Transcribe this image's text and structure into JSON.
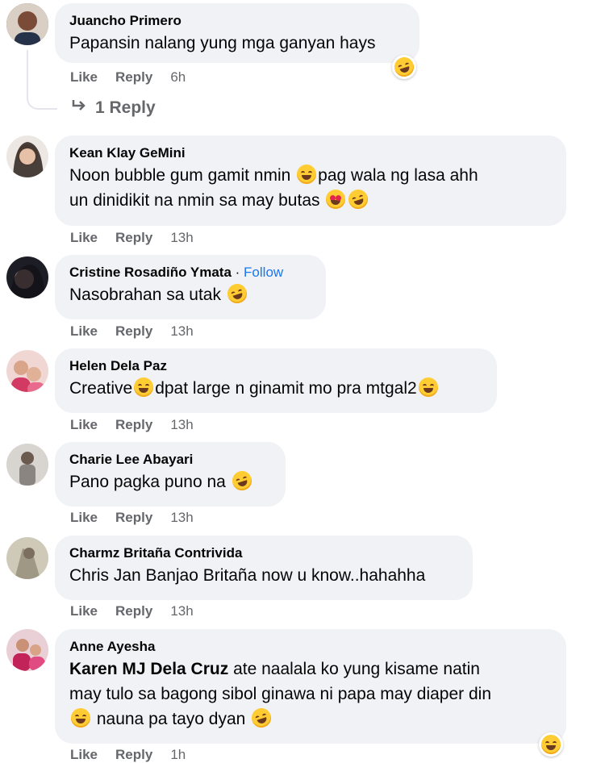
{
  "actions": {
    "like": "Like",
    "reply": "Reply"
  },
  "comments": [
    {
      "author": "Juancho Primero",
      "text": "Papansin nalang yung mga ganyan hays",
      "time": "6h",
      "avatar_color": "#7a4b36",
      "replies_label": "1 Reply"
    },
    {
      "author": "Kean Klay GeMini",
      "text_part1": "Noon bubble gum gamit nmin ",
      "text_part2": "pag wala ng lasa ahh",
      "text_part3": "un dinidikit na nmin sa may butas ",
      "time": "13h",
      "avatar_color": "#3b2f2a"
    },
    {
      "author": "Cristine Rosadiño Ymata",
      "separator": "·",
      "follow": "Follow",
      "text": "Nasobrahan sa utak ",
      "time": "13h",
      "avatar_color": "#2c2a33"
    },
    {
      "author": "Helen Dela Paz",
      "text_part1": "Creative",
      "text_part2": "dpat large n ginamit mo pra mtgal2",
      "time": "13h",
      "avatar_color": "#c9506a"
    },
    {
      "author": "Charie Lee Abayari",
      "text": "Pano pagka puno na ",
      "time": "13h",
      "avatar_color": "#a7a19a"
    },
    {
      "author": "Charmz Britaña Contrivida",
      "text": "Chris Jan Banjao Britaña now u know..hahahha",
      "time": "13h",
      "avatar_color": "#b9b4a5"
    },
    {
      "author": "Anne Ayesha",
      "mention": "Karen MJ Dela Cruz",
      "text_line1": " ate naalala ko yung kisame natin",
      "text_line2": "may tulo sa bagong sibol ginawa ni papa may diaper din",
      "text_line3": " nauna pa tayo dyan ",
      "time": "1h",
      "avatar_color": "#b23b5c"
    }
  ],
  "icons": {
    "reply_arrow": "reply-arrow-icon",
    "emoji": "laughing-emoji-icon"
  }
}
